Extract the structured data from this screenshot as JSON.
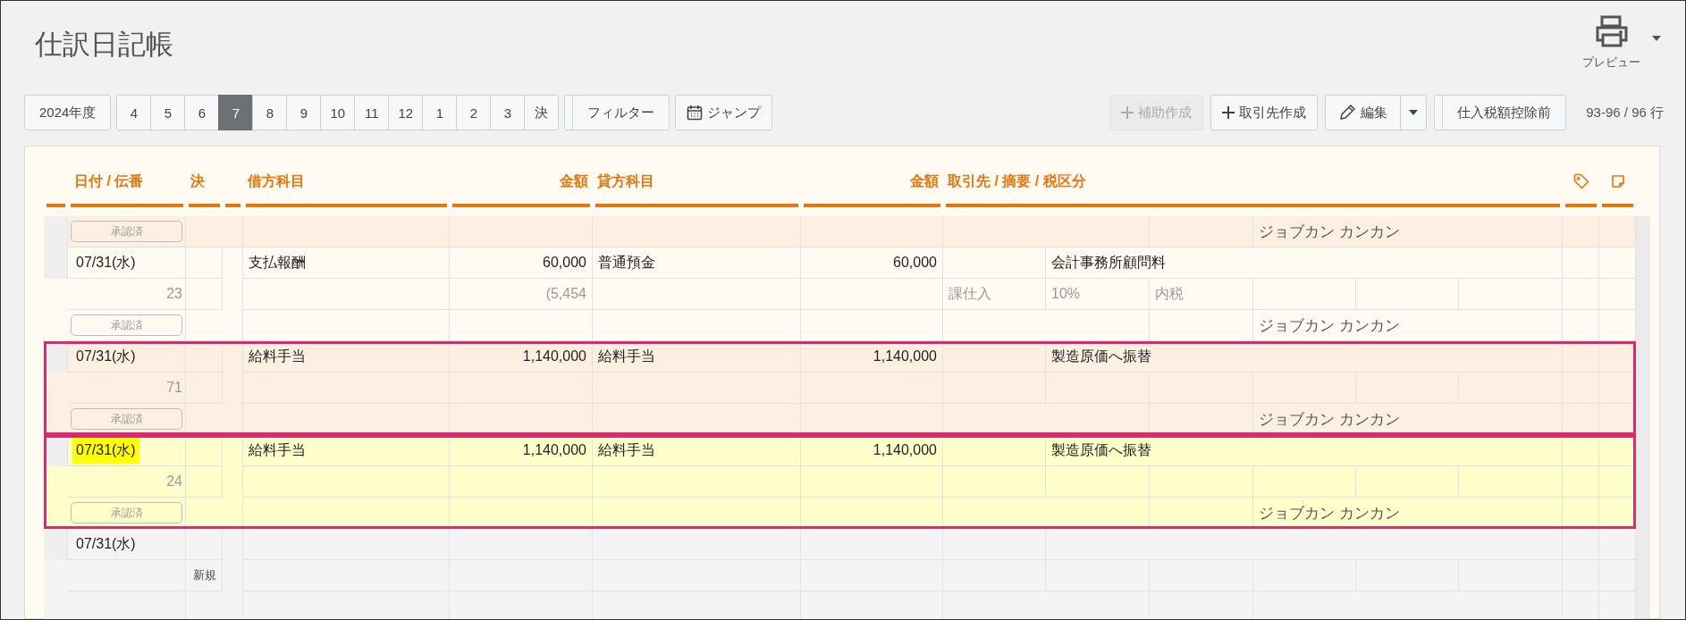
{
  "page": {
    "title": "仕訳日記帳",
    "preview_label": "プレビュー"
  },
  "toolbar": {
    "fiscal_year": "2024年度",
    "months": [
      {
        "label": "4",
        "selected": false
      },
      {
        "label": "5",
        "selected": false
      },
      {
        "label": "6",
        "selected": false
      },
      {
        "label": "7",
        "selected": true
      },
      {
        "label": "8",
        "selected": false
      },
      {
        "label": "9",
        "selected": false
      },
      {
        "label": "10",
        "selected": false
      },
      {
        "label": "11",
        "selected": false
      },
      {
        "label": "12",
        "selected": false
      },
      {
        "label": "1",
        "selected": false
      },
      {
        "label": "2",
        "selected": false
      },
      {
        "label": "3",
        "selected": false
      },
      {
        "label": "決",
        "selected": false
      }
    ],
    "filter": "フィルター",
    "jump": "ジャンプ",
    "add_sub": {
      "label": "補助作成",
      "disabled": true
    },
    "add_partner": {
      "label": "取引先作成",
      "disabled": false
    },
    "edit": "編集",
    "tax_mode": "仕入税額控除前",
    "row_count": "93-96 / 96 行"
  },
  "table": {
    "columns": [
      "日付 / 伝番",
      "決",
      "借方科目",
      "金額",
      "貸方科目",
      "金額",
      "取引先 / 摘要 / 税区分"
    ],
    "entries": [
      {
        "kind": "shaded",
        "partial": true,
        "outlined": false,
        "approval": "承認済",
        "partner": "ジョブカン カンカン"
      },
      {
        "kind": "plain",
        "partial": false,
        "outlined": false,
        "date": "07/31(水)",
        "date_highlighted": false,
        "number": "23",
        "debit": "支払報酬",
        "debit_amount": "60,000",
        "debit_tax": "(5,454",
        "credit": "普通預金",
        "credit_amount": "60,000",
        "memo": "会計事務所顧問料",
        "tax": [
          "課仕入",
          "10%",
          "内税"
        ],
        "approval": "承認済",
        "partner": "ジョブカン カンカン"
      },
      {
        "kind": "shaded",
        "partial": false,
        "outlined": true,
        "date": "07/31(水)",
        "date_highlighted": false,
        "number": "71",
        "debit": "給料手当",
        "debit_amount": "1,140,000",
        "credit": "給料手当",
        "credit_amount": "1,140,000",
        "memo": "製造原価へ振替",
        "approval": "承認済",
        "partner": "ジョブカン カンカン"
      },
      {
        "kind": "current",
        "partial": false,
        "outlined": true,
        "date": "07/31(水)",
        "date_highlighted": true,
        "number": "24",
        "debit": "給料手当",
        "debit_amount": "1,140,000",
        "credit": "給料手当",
        "credit_amount": "1,140,000",
        "memo": "製造原価へ振替",
        "approval": "承認済",
        "partner": "ジョブカン カンカン"
      },
      {
        "kind": "new",
        "partial": false,
        "outlined": false,
        "date": "07/31(水)",
        "date_highlighted": false,
        "status": "新規"
      }
    ]
  }
}
